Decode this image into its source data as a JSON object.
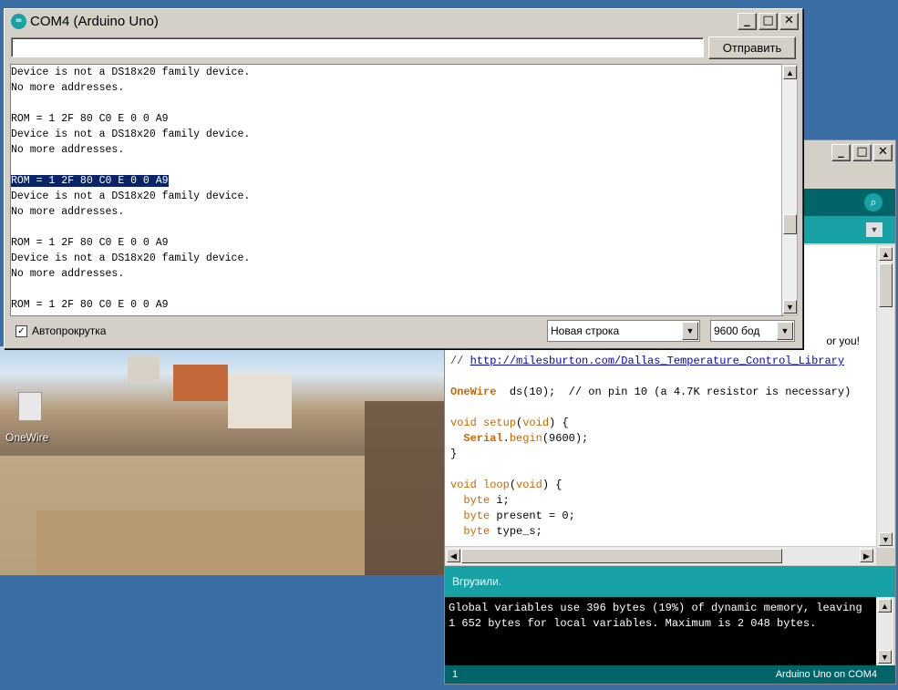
{
  "desktop": {
    "icon_label": "OneWire"
  },
  "serial_monitor": {
    "title": "COM4 (Arduino Uno)",
    "send_input_value": "",
    "send_button": "Отправить",
    "output_lines": [
      "Device is not a DS18x20 family device.",
      "No more addresses.",
      "",
      "ROM = 1 2F 80 C0 E 0 0 A9",
      "Device is not a DS18x20 family device.",
      "No more addresses.",
      "",
      "ROM = 1 2F 80 C0 E 0 0 A9",
      "Device is not a DS18x20 family device.",
      "No more addresses.",
      "",
      "ROM = 1 2F 80 C0 E 0 0 A9",
      "Device is not a DS18x20 family device.",
      "No more addresses.",
      "",
      "ROM = 1 2F 80 C0 E 0 0 A9"
    ],
    "selected_line_index": 7,
    "autoscroll_label": "Автопрокрутка",
    "autoscroll_checked": true,
    "line_ending": "Новая строка",
    "baud_rate": "9600 бод"
  },
  "ide": {
    "code_lines": [
      {
        "parts": [
          {
            "t": "// http://milesburton.com/Dallas_Temperature_Control_Library",
            "c": "cm"
          }
        ]
      },
      {
        "parts": [
          {
            "t": "",
            "c": ""
          }
        ]
      },
      {
        "parts": [
          {
            "t": "OneWire",
            "c": "kwb"
          },
          {
            "t": "  ds(10);  // on pin 10 (a 4.7K resistor is necessary)",
            "c": ""
          }
        ]
      },
      {
        "parts": [
          {
            "t": "",
            "c": ""
          }
        ]
      },
      {
        "parts": [
          {
            "t": "void",
            "c": "kw"
          },
          {
            "t": " ",
            "c": ""
          },
          {
            "t": "setup",
            "c": "kw"
          },
          {
            "t": "(",
            "c": ""
          },
          {
            "t": "void",
            "c": "kw"
          },
          {
            "t": ") {",
            "c": ""
          }
        ]
      },
      {
        "parts": [
          {
            "t": "  ",
            "c": ""
          },
          {
            "t": "Serial",
            "c": "kwb"
          },
          {
            "t": ".",
            "c": ""
          },
          {
            "t": "begin",
            "c": "kw"
          },
          {
            "t": "(9600);",
            "c": ""
          }
        ]
      },
      {
        "parts": [
          {
            "t": "}",
            "c": ""
          }
        ]
      },
      {
        "parts": [
          {
            "t": "",
            "c": ""
          }
        ]
      },
      {
        "parts": [
          {
            "t": "void",
            "c": "kw"
          },
          {
            "t": " ",
            "c": ""
          },
          {
            "t": "loop",
            "c": "kw"
          },
          {
            "t": "(",
            "c": ""
          },
          {
            "t": "void",
            "c": "kw"
          },
          {
            "t": ") {",
            "c": ""
          }
        ]
      },
      {
        "parts": [
          {
            "t": "  ",
            "c": ""
          },
          {
            "t": "byte",
            "c": "kw"
          },
          {
            "t": " i;",
            "c": ""
          }
        ]
      },
      {
        "parts": [
          {
            "t": "  ",
            "c": ""
          },
          {
            "t": "byte",
            "c": "kw"
          },
          {
            "t": " present = 0;",
            "c": ""
          }
        ]
      },
      {
        "parts": [
          {
            "t": "  ",
            "c": ""
          },
          {
            "t": "byte",
            "c": "kw"
          },
          {
            "t": " type_s;",
            "c": ""
          }
        ]
      }
    ],
    "partial_comment_tail": "or you!",
    "status_message": "Вгрузили.",
    "console_lines": [
      "Global variables use 396 bytes (19%) of dynamic memory, leaving",
      "1 652 bytes for local variables. Maximum is 2 048 bytes."
    ],
    "footer_line": "1",
    "footer_board": "Arduino Uno on COM4",
    "colors": {
      "toolbar": "#006468",
      "status": "#17a1a5"
    }
  }
}
